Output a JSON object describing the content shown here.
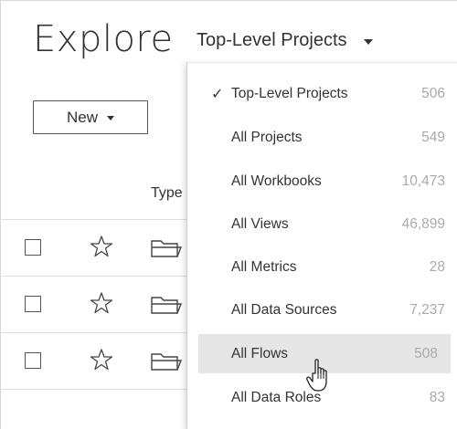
{
  "page": {
    "title": "Explore"
  },
  "project_filter": {
    "selected_label": "Top-Level Projects",
    "options": [
      {
        "label": "Top-Level Projects",
        "count": "506",
        "selected": true
      },
      {
        "label": "All Projects",
        "count": "549"
      },
      {
        "label": "All Workbooks",
        "count": "10,473"
      },
      {
        "label": "All Views",
        "count": "46,899"
      },
      {
        "label": "All Metrics",
        "count": "28"
      },
      {
        "label": "All Data Sources",
        "count": "7,237"
      },
      {
        "label": "All Flows",
        "count": "508",
        "hovered": true
      },
      {
        "label": "All Data Roles",
        "count": "83"
      }
    ],
    "check_glyph": "✓"
  },
  "toolbar": {
    "new_label": "New"
  },
  "table": {
    "columns": {
      "type": "Type"
    },
    "rows": [
      {
        "icon": "folder-icon"
      },
      {
        "icon": "folder-icon"
      },
      {
        "icon": "folder-icon"
      }
    ]
  },
  "colors": {
    "hover_bg": "#e6e6e6",
    "count_text": "#aaaaaa",
    "text": "#333333"
  }
}
